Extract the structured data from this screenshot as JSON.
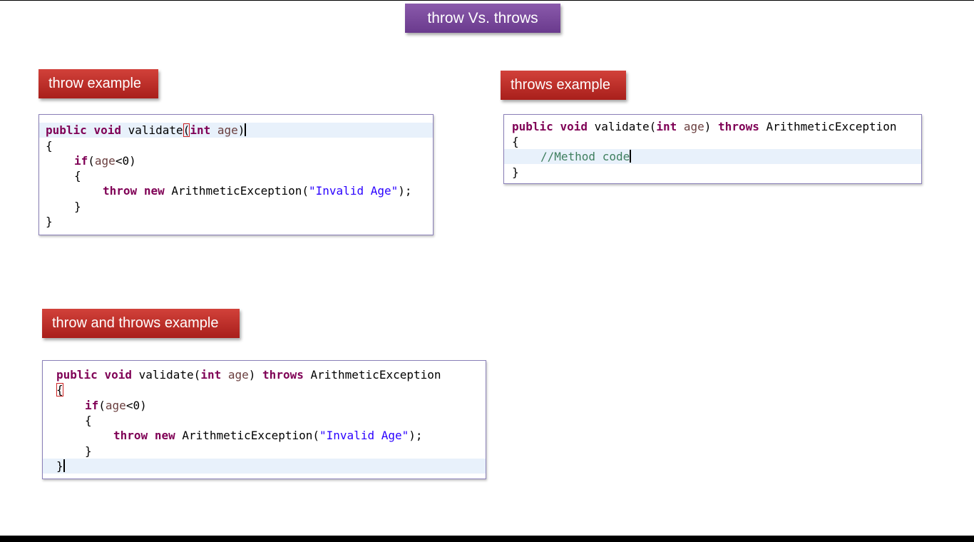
{
  "title": "throw Vs. throws",
  "sections": {
    "throw": {
      "label": "throw example",
      "lines": {
        "l1": {
          "kw1": "public",
          "kw2": "void",
          "t1": "validate",
          "paren": "(",
          "kw3": "int",
          "var": "age",
          "t2": ")"
        },
        "l2": {
          "t": "{"
        },
        "l3": {
          "kw": "if",
          "t1": "(",
          "var": "age",
          "t2": "<0)"
        },
        "l4": {
          "t": "{"
        },
        "l5": {
          "kw1": "throw",
          "kw2": "new",
          "t1": "ArithmeticException(",
          "str": "\"Invalid Age\"",
          "t2": ");"
        },
        "l6": {
          "t": "}"
        },
        "l7": {
          "t": "}"
        }
      }
    },
    "throws": {
      "label": "throws example",
      "lines": {
        "l1": {
          "kw1": "public",
          "kw2": "void",
          "t1": "validate(",
          "kw3": "int",
          "var": "age",
          "t2": ")",
          "kw4": "throws",
          "t3": "ArithmeticException"
        },
        "l2": {
          "t": "{"
        },
        "l3": {
          "cmt": "//Method code"
        },
        "l4": {
          "t": "}"
        }
      }
    },
    "both": {
      "label": "throw and throws example",
      "lines": {
        "l1": {
          "kw1": "public",
          "kw2": "void",
          "t1": "validate(",
          "kw3": "int",
          "var": "age",
          "t2": ")",
          "kw4": "throws",
          "t3": "ArithmeticException"
        },
        "l2": {
          "t": "{"
        },
        "l3": {
          "kw": "if",
          "t1": "(",
          "var": "age",
          "t2": "<0)"
        },
        "l4": {
          "t": "{"
        },
        "l5": {
          "kw1": "throw",
          "kw2": "new",
          "t1": "ArithmeticException(",
          "str": "\"Invalid Age\"",
          "t2": ");"
        },
        "l6": {
          "t": "}"
        },
        "l7": {
          "t": "}"
        }
      }
    }
  },
  "colors": {
    "title_bg": "#7a4a9d",
    "label_bg": "#c0302a",
    "keyword": "#7f0055",
    "variable": "#6a3e3e",
    "string": "#2a00ff",
    "comment": "#3f7f5f",
    "highlight_line": "#e8f1fb",
    "bracket_match": "#cc2222"
  }
}
